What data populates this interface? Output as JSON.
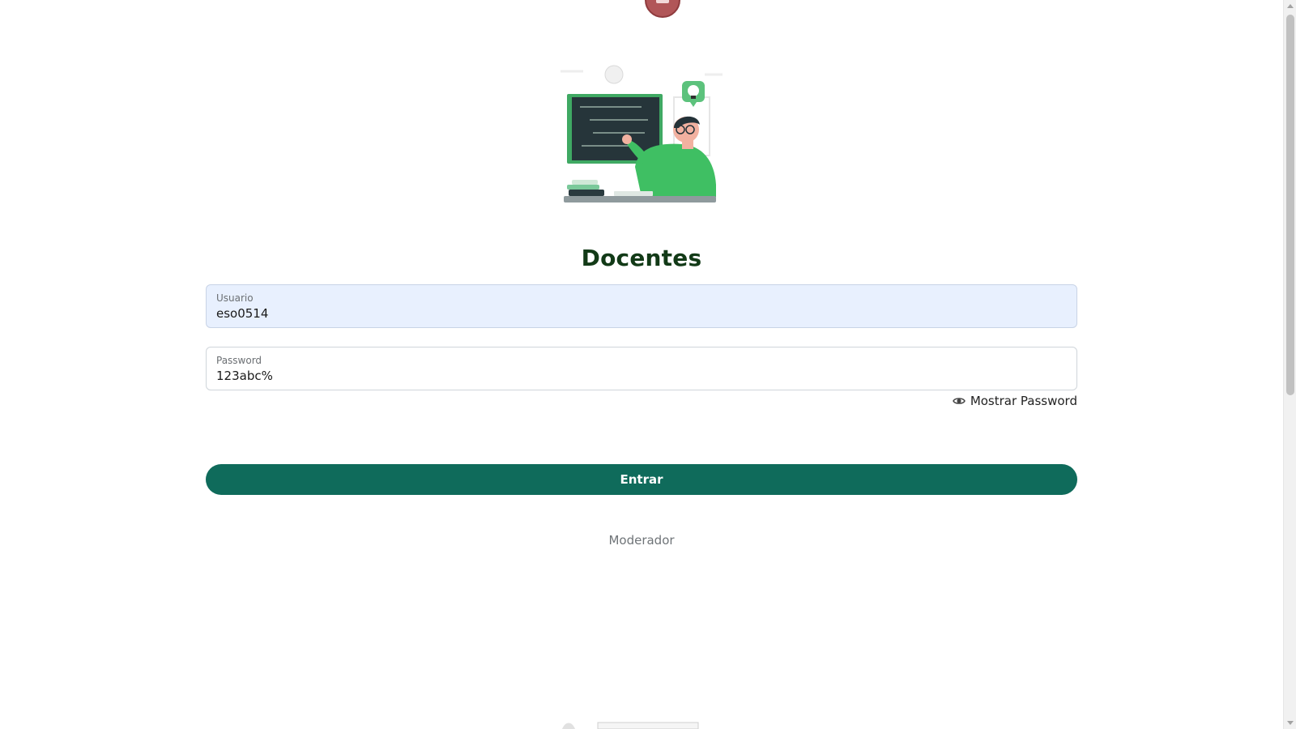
{
  "page": {
    "title": "Docentes"
  },
  "form": {
    "username": {
      "label": "Usuario",
      "value": "eso0514"
    },
    "password": {
      "label": "Password",
      "value": "123abc%"
    },
    "show_password_label": "Mostrar Password",
    "submit_label": "Entrar",
    "moderator_link": "Moderador"
  },
  "icons": {
    "top_logo": "app-logo-icon",
    "hero": "teacher-at-blackboard-illustration",
    "eye": "eye-icon"
  },
  "colors": {
    "title": "#123a17",
    "primary_button": "#0f6b5b",
    "autofill_background": "#e8f0fe",
    "link_gray": "#6f7478"
  }
}
